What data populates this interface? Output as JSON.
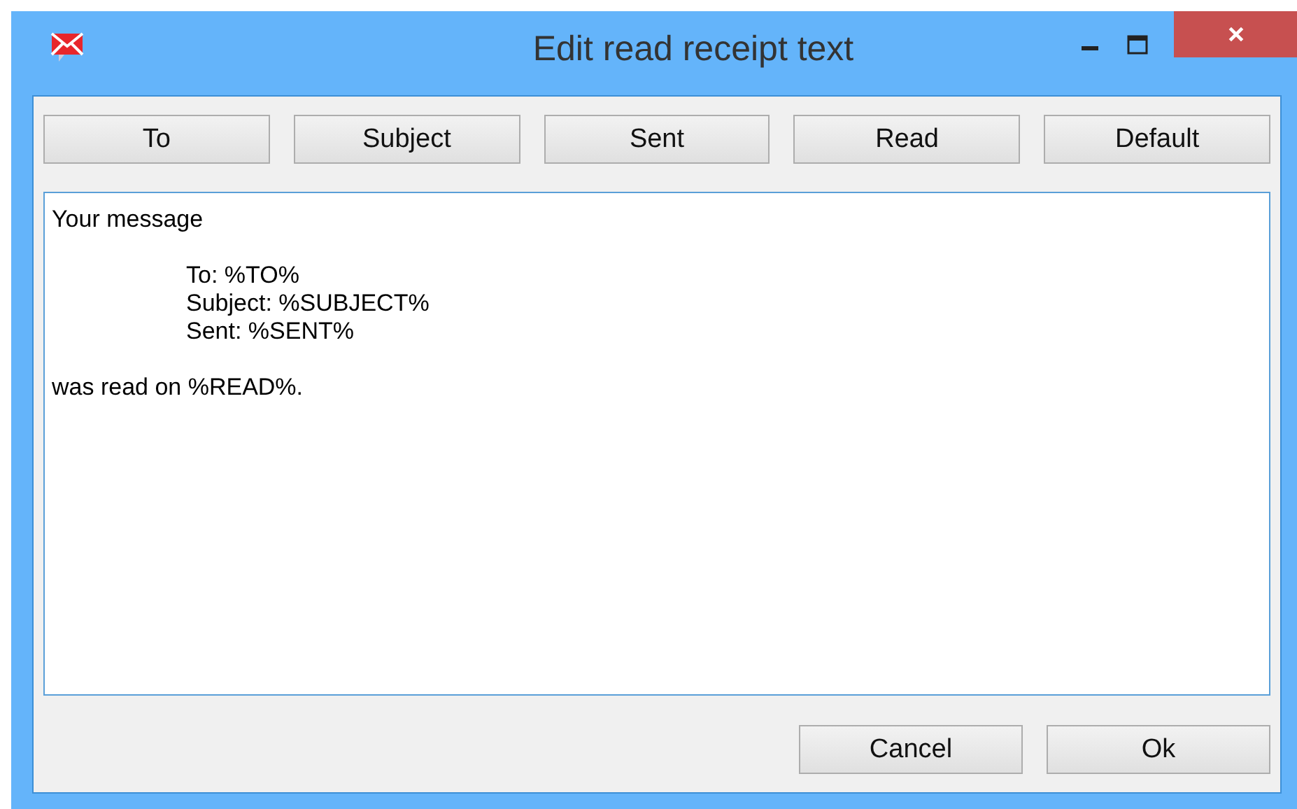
{
  "window": {
    "title": "Edit read receipt text"
  },
  "insert_buttons": [
    "To",
    "Subject",
    "Sent",
    "Read",
    "Default"
  ],
  "editor": {
    "value": "Your message\n\n\t\tTo: %TO%\n\t\tSubject: %SUBJECT%\n\t\tSent: %SENT%\n\nwas read on %READ%."
  },
  "buttons": [
    "Cancel",
    "Ok"
  ]
}
